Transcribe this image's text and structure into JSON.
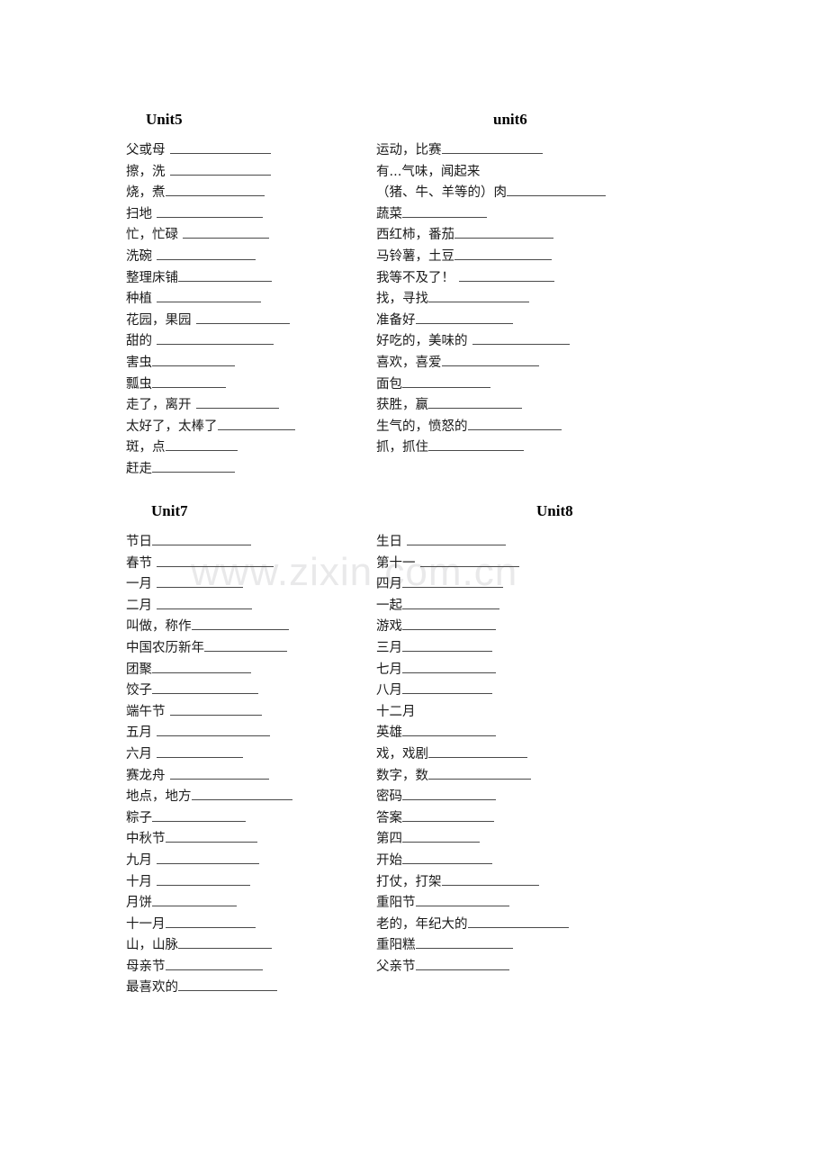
{
  "document": {
    "watermark": "www.zixin.com.cn"
  },
  "units": [
    {
      "id": "unit5",
      "title": "Unit5",
      "entries": [
        {
          "term": "父或母",
          "gap": true,
          "rule": 112
        },
        {
          "term": "擦，洗",
          "gap": true,
          "rule": 112
        },
        {
          "term": "烧，煮",
          "gap": false,
          "rule": 110
        },
        {
          "term": "扫地",
          "gap": true,
          "rule": 118
        },
        {
          "term": "忙，忙碌",
          "gap": true,
          "rule": 96
        },
        {
          "term": "洗碗",
          "gap": true,
          "rule": 110
        },
        {
          "term": "整理床铺",
          "gap": false,
          "rule": 104
        },
        {
          "term": "种植",
          "gap": true,
          "rule": 116
        },
        {
          "term": "花园，果园",
          "gap": true,
          "rule": 104
        },
        {
          "term": "甜的",
          "gap": true,
          "rule": 130
        },
        {
          "term": "害虫",
          "gap": false,
          "rule": 92
        },
        {
          "term": "瓢虫",
          "gap": false,
          "rule": 82
        },
        {
          "term": "走了，离开",
          "gap": true,
          "rule": 92
        },
        {
          "term": "太好了，太棒了",
          "gap": false,
          "rule": 86
        },
        {
          "term": "斑，点",
          "gap": false,
          "rule": 80
        },
        {
          "term": "赶走",
          "gap": false,
          "rule": 92
        }
      ]
    },
    {
      "id": "unit6",
      "title": "unit6",
      "entries": [
        {
          "term": " 运动，比赛",
          "gap": false,
          "rule": 112
        },
        {
          "term": " 有...气味，闻起来",
          "gap": false,
          "rule": 0
        },
        {
          "term": "（猪、牛、羊等的）肉",
          "gap": false,
          "rule": 110
        },
        {
          "term": " 蔬菜",
          "gap": false,
          "rule": 94
        },
        {
          "term": " 西红柿，番茄",
          "gap": false,
          "rule": 110
        },
        {
          "term": "马铃薯，土豆",
          "gap": false,
          "rule": 108
        },
        {
          "term": "我等不及了！",
          "gap": true,
          "rule": 106
        },
        {
          "term": "找，寻找",
          "gap": false,
          "rule": 112
        },
        {
          "term": "准备好",
          "gap": false,
          "rule": 108
        },
        {
          "term": "好吃的，美味的",
          "gap": true,
          "rule": 108
        },
        {
          "term": "喜欢，喜爱",
          "gap": false,
          "rule": 108
        },
        {
          "term": "面包",
          "gap": false,
          "rule": 98
        },
        {
          "term": "获胜，赢",
          "gap": false,
          "rule": 104
        },
        {
          "term": "生气的，愤怒的",
          "gap": false,
          "rule": 104
        },
        {
          "term": "抓，抓住",
          "gap": false,
          "rule": 106
        }
      ]
    },
    {
      "id": "unit7",
      "title": "Unit7",
      "entries": [
        {
          "term": "节日",
          "gap": false,
          "rule": 110
        },
        {
          "term": "春节",
          "gap": true,
          "rule": 130
        },
        {
          "term": "一月",
          "gap": true,
          "rule": 96
        },
        {
          "term": "二月",
          "gap": true,
          "rule": 106
        },
        {
          "term": "叫做，称作",
          "gap": false,
          "rule": 108
        },
        {
          "term": "中国农历新年",
          "gap": false,
          "rule": 92
        },
        {
          "term": "团聚",
          "gap": false,
          "rule": 110
        },
        {
          "term": "饺子",
          "gap": false,
          "rule": 118
        },
        {
          "term": "端午节",
          "gap": true,
          "rule": 102
        },
        {
          "term": "五月",
          "gap": true,
          "rule": 126
        },
        {
          "term": " 六月",
          "gap": true,
          "rule": 96
        },
        {
          "term": "赛龙舟",
          "gap": true,
          "rule": 110
        },
        {
          "term": "地点，地方",
          "gap": false,
          "rule": 112
        },
        {
          "term": "粽子",
          "gap": false,
          "rule": 104
        },
        {
          "term": "中秋节",
          "gap": false,
          "rule": 102
        },
        {
          "term": "九月",
          "gap": true,
          "rule": 114
        },
        {
          "term": "十月",
          "gap": true,
          "rule": 104
        },
        {
          "term": "月饼",
          "gap": false,
          "rule": 94
        },
        {
          "term": "十一月",
          "gap": false,
          "rule": 100
        },
        {
          "term": "山，山脉",
          "gap": false,
          "rule": 104
        },
        {
          "term": "母亲节",
          "gap": false,
          "rule": 108
        },
        {
          "term": "最喜欢的",
          "gap": false,
          "rule": 110
        }
      ]
    },
    {
      "id": "unit8",
      "title": "Unit8",
      "entries": [
        {
          "term": " 生日",
          "gap": true,
          "rule": 110
        },
        {
          "term": " 第十一",
          "gap": true,
          "rule": 110
        },
        {
          "term": " 四月",
          "gap": false,
          "rule": 112
        },
        {
          "term": "  一起",
          "gap": false,
          "rule": 108
        },
        {
          "term": "游戏",
          "gap": false,
          "rule": 104
        },
        {
          "term": "三月",
          "gap": false,
          "rule": 100
        },
        {
          "term": "七月",
          "gap": false,
          "rule": 104
        },
        {
          "term": "八月",
          "gap": false,
          "rule": 100
        },
        {
          "term": "十二月",
          "gap": false,
          "rule": 0
        },
        {
          "term": "英雄",
          "gap": false,
          "rule": 104
        },
        {
          "term": "戏，戏剧",
          "gap": false,
          "rule": 110
        },
        {
          "term": "数字，数",
          "gap": false,
          "rule": 114
        },
        {
          "term": "密码",
          "gap": false,
          "rule": 104
        },
        {
          "term": "答案",
          "gap": false,
          "rule": 102
        },
        {
          "term": "第四",
          "gap": false,
          "rule": 86
        },
        {
          "term": "开始",
          "gap": false,
          "rule": 100
        },
        {
          "term": "打仗，打架",
          "gap": false,
          "rule": 108
        },
        {
          "term": "重阳节",
          "gap": false,
          "rule": 104
        },
        {
          "term": "老的，年纪大的",
          "gap": false,
          "rule": 112
        },
        {
          "term": "重阳糕",
          "gap": false,
          "rule": 108
        },
        {
          "term": "父亲节",
          "gap": false,
          "rule": 104
        }
      ]
    }
  ]
}
